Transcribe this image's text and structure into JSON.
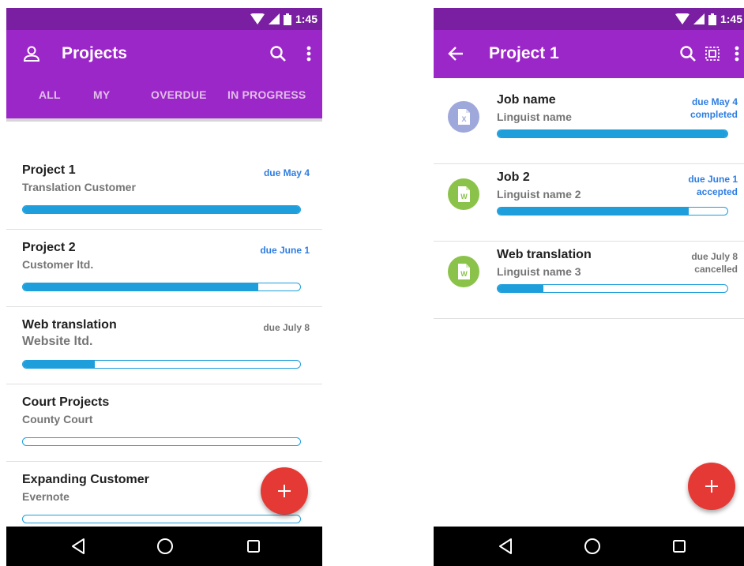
{
  "status": {
    "time": "1:45"
  },
  "colors": {
    "status_bar": "#7b1fa2",
    "app_bar": "#9c27c9",
    "progress": "#1e9fdc",
    "due_accent": "#2e7de1",
    "fab": "#e53935",
    "avatar_excel": "#9fa8da",
    "avatar_word": "#8bc34a"
  },
  "projects_screen": {
    "title": "Projects",
    "tabs": [
      "ALL",
      "MY",
      "OVERDUE",
      "IN PROGRESS"
    ],
    "projects": [
      {
        "name": "Project 1",
        "customer": "Translation Customer",
        "due": "due May 4",
        "due_color": "#2e7de1",
        "progress": 1.0
      },
      {
        "name": "Project 2",
        "customer": "Customer ltd.",
        "due": "due June 1",
        "due_color": "#2e7de1",
        "progress": 0.85
      },
      {
        "name": "Web translation",
        "customer": "Website ltd.",
        "due": "due July 8",
        "due_color": "#757575",
        "progress": 0.26
      },
      {
        "name": "Court Projects",
        "customer": "County Court",
        "due": "",
        "due_color": "#757575",
        "progress": 0.0
      },
      {
        "name": "Expanding Customer",
        "customer": "Evernote",
        "due": "",
        "due_color": "#757575",
        "progress": 0.0
      }
    ],
    "fab_icon": "plus-icon"
  },
  "project_detail_screen": {
    "title": "Project 1",
    "jobs": [
      {
        "name": "Job name",
        "linguist": "Linguist name",
        "due": "due May 4",
        "status": "completed",
        "text_color": "#2e7de1",
        "file_icon": "excel-file-icon",
        "progress": 1.0
      },
      {
        "name": "Job 2",
        "linguist": "Linguist name 2",
        "due": "due June 1",
        "status": "accepted",
        "text_color": "#2e7de1",
        "file_icon": "word-file-icon",
        "progress": 0.83
      },
      {
        "name": "Web translation",
        "linguist": "Linguist name 3",
        "due": "due July 8",
        "status": "cancelled",
        "text_color": "#757575",
        "file_icon": "word-file-icon",
        "progress": 0.2
      }
    ],
    "fab_icon": "plus-icon"
  }
}
